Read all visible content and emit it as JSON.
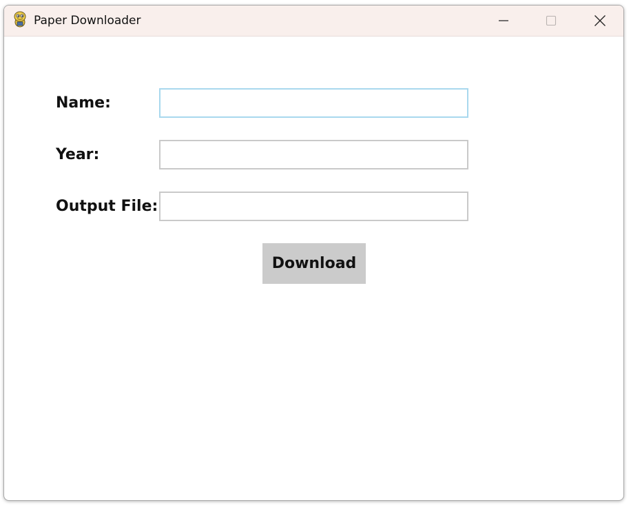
{
  "window": {
    "title": "Paper Downloader",
    "app_icon": "python-snake-icon"
  },
  "controls": {
    "minimize_icon": "minimize-icon",
    "maximize_icon": "maximize-icon",
    "close_icon": "close-icon"
  },
  "form": {
    "name_label": "Name:",
    "name_value": "",
    "year_label": "Year:",
    "year_value": "",
    "output_label": "Output File:",
    "output_value": "",
    "download_label": "Download"
  },
  "colors": {
    "titlebar": "#f9efec",
    "focus_border": "#a8d8ee",
    "field_border": "#c9c9c9",
    "button_bg": "#cbcbcb"
  }
}
